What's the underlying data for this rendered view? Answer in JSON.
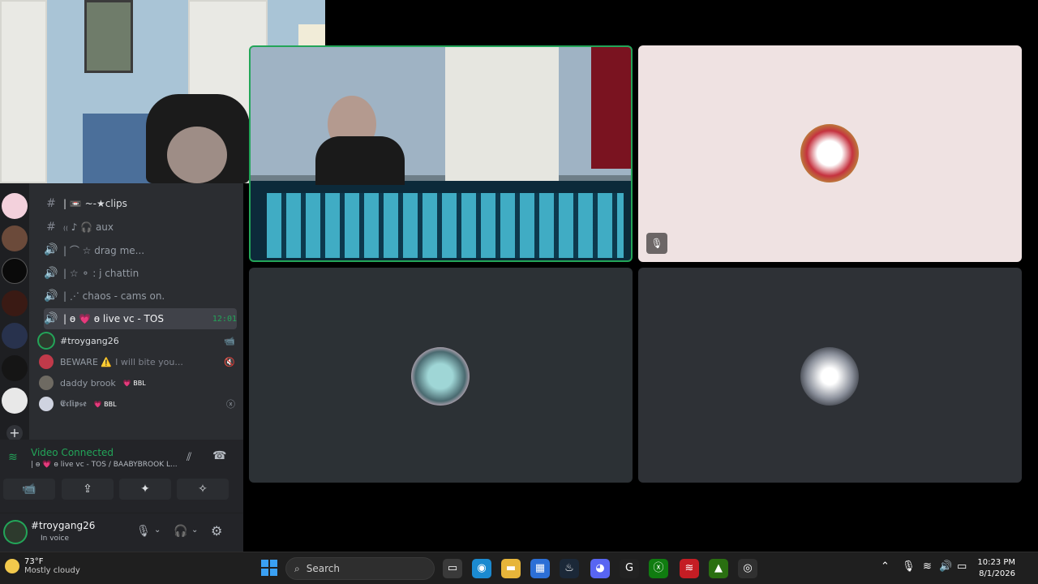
{
  "channels": [
    {
      "icon": "#",
      "label": "| 📼 ~-★clips",
      "type": "text"
    },
    {
      "icon": "#",
      "label": "₍₍ ♪ 🎧 aux",
      "type": "text"
    },
    {
      "icon": "🔊",
      "label": "| ⌒ ☆ drag me...",
      "type": "voice"
    },
    {
      "icon": "🔊",
      "label": "| ☆ ⚬ : j chattin",
      "type": "voice"
    },
    {
      "icon": "🔊",
      "label": "| ⋰ chaos - cams on.",
      "type": "voice"
    },
    {
      "icon": "🔊",
      "label": "| ɵ 💗 ɵ live vc - TOS",
      "type": "voice-active",
      "time": "12:01"
    }
  ],
  "members": [
    {
      "name": "#troygang26",
      "status": "",
      "badge": "",
      "trail": "📹"
    },
    {
      "name": "BEWARE ⚠️",
      "status": "I will bite you...",
      "badge": "",
      "trail": "🔇"
    },
    {
      "name": "daddy brook",
      "status": "",
      "badge": "💗 BBL",
      "trail": ""
    },
    {
      "name": "𝕰𝖈𝖑𝖎𝖕𝖘𝖊",
      "status": "",
      "badge": "💗 BBL",
      "trail": "ⓧ"
    }
  ],
  "voice": {
    "title": "Video Connected",
    "subtitle": "| ɵ 💗 ɵ live vc - TOS / BAABYBROOK L...",
    "buttons": [
      "📹",
      "⇪",
      "✦",
      "✧"
    ]
  },
  "user": {
    "name": "#troygang26",
    "status": "In voice"
  },
  "taskbar": {
    "temp": "73°F",
    "weather": "Mostly cloudy",
    "search": "Search",
    "time": "10:23 PM",
    "date": "8/1/2026"
  },
  "colors": {
    "green": "#23a559",
    "sidebar": "#2b2d31",
    "accent": "#5865f2"
  }
}
